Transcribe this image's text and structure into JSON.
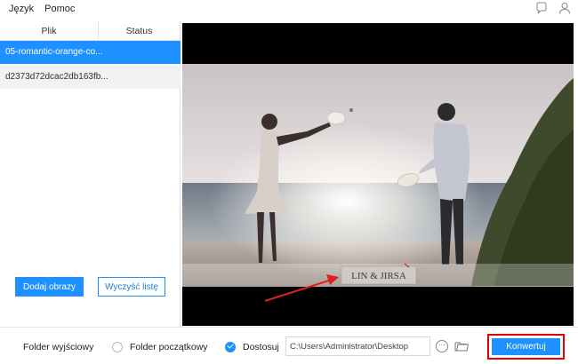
{
  "menu": {
    "language": "Język",
    "help": "Pomoc"
  },
  "file_table": {
    "col_file": "Plik",
    "col_status": "Status",
    "rows": [
      {
        "name": "05-romantic-orange-co...",
        "status": ""
      },
      {
        "name": "d2373d72dcac2db163fb...",
        "status": ""
      }
    ]
  },
  "buttons": {
    "add_images": "Dodaj obrazy",
    "clear_list": "Wyczyść listę",
    "convert": "Konwertuj"
  },
  "watermark": {
    "text": "LIN & JIRSA"
  },
  "output": {
    "label": "Folder wyjściowy",
    "option_original": "Folder początkowy",
    "option_custom": "Dostosuj",
    "selected": "custom",
    "path": "C:\\Users\\Administrator\\Desktop"
  },
  "icons": {
    "chat": "chat-bubble-icon",
    "user": "user-icon",
    "more": "more-options-icon",
    "folder": "folder-icon"
  },
  "colors": {
    "accent": "#1e90ff",
    "highlight_border": "#e00000",
    "annotation_arrow": "#e02020"
  }
}
